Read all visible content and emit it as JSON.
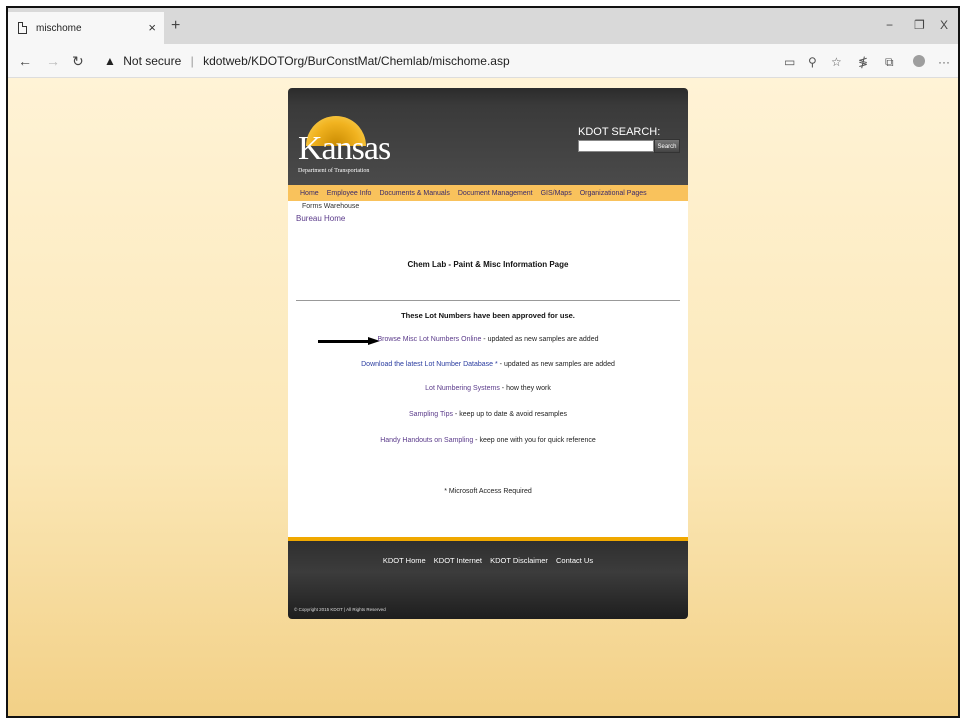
{
  "browser": {
    "tab_title": "mischome",
    "tab_close": "×",
    "new_tab": "+",
    "minimize": "−",
    "restore": "❐",
    "close": "X",
    "back": "←",
    "forward": "→",
    "refresh": "↻",
    "security_icon": "▲",
    "security_text": "Not secure",
    "url": "kdotweb/KDOTOrg/BurConstMat/Chemlab/mischome.asp",
    "more": "···"
  },
  "site": {
    "logo_word": "Kansas",
    "logo_dept": "Department of Transportation",
    "search_label": "KDOT SEARCH:",
    "search_button": "Search",
    "nav": [
      "Home",
      "Employee Info",
      "Documents & Manuals",
      "Document Management",
      "GIS/Maps",
      "Organizational Pages"
    ],
    "forms_warehouse": "Forms Warehouse",
    "bureau_home": "Bureau Home",
    "page_title": "Chem Lab - Paint & Misc Information Page",
    "approved_heading": "These Lot Numbers have been approved for use.",
    "items": [
      {
        "link": "Browse Misc Lot Numbers Online",
        "text": " - updated as new samples are added"
      },
      {
        "link": "Download the latest Lot Number Database *",
        "text": " - updated as new samples are added"
      },
      {
        "link": "Lot Numbering Systems",
        "text": " - how they work"
      },
      {
        "link": "Sampling Tips",
        "text": " - keep up to date & avoid resamples"
      },
      {
        "link": "Handy Handouts on Sampling",
        "text": " - keep one with you for quick reference"
      }
    ],
    "note": "* Microsoft Access Required",
    "footer_links": [
      "KDOT Home",
      "KDOT Internet",
      "KDOT Disclaimer",
      "Contact Us"
    ],
    "copyright": "© Copyright 2015 KDOT | All Rights Reserved"
  }
}
